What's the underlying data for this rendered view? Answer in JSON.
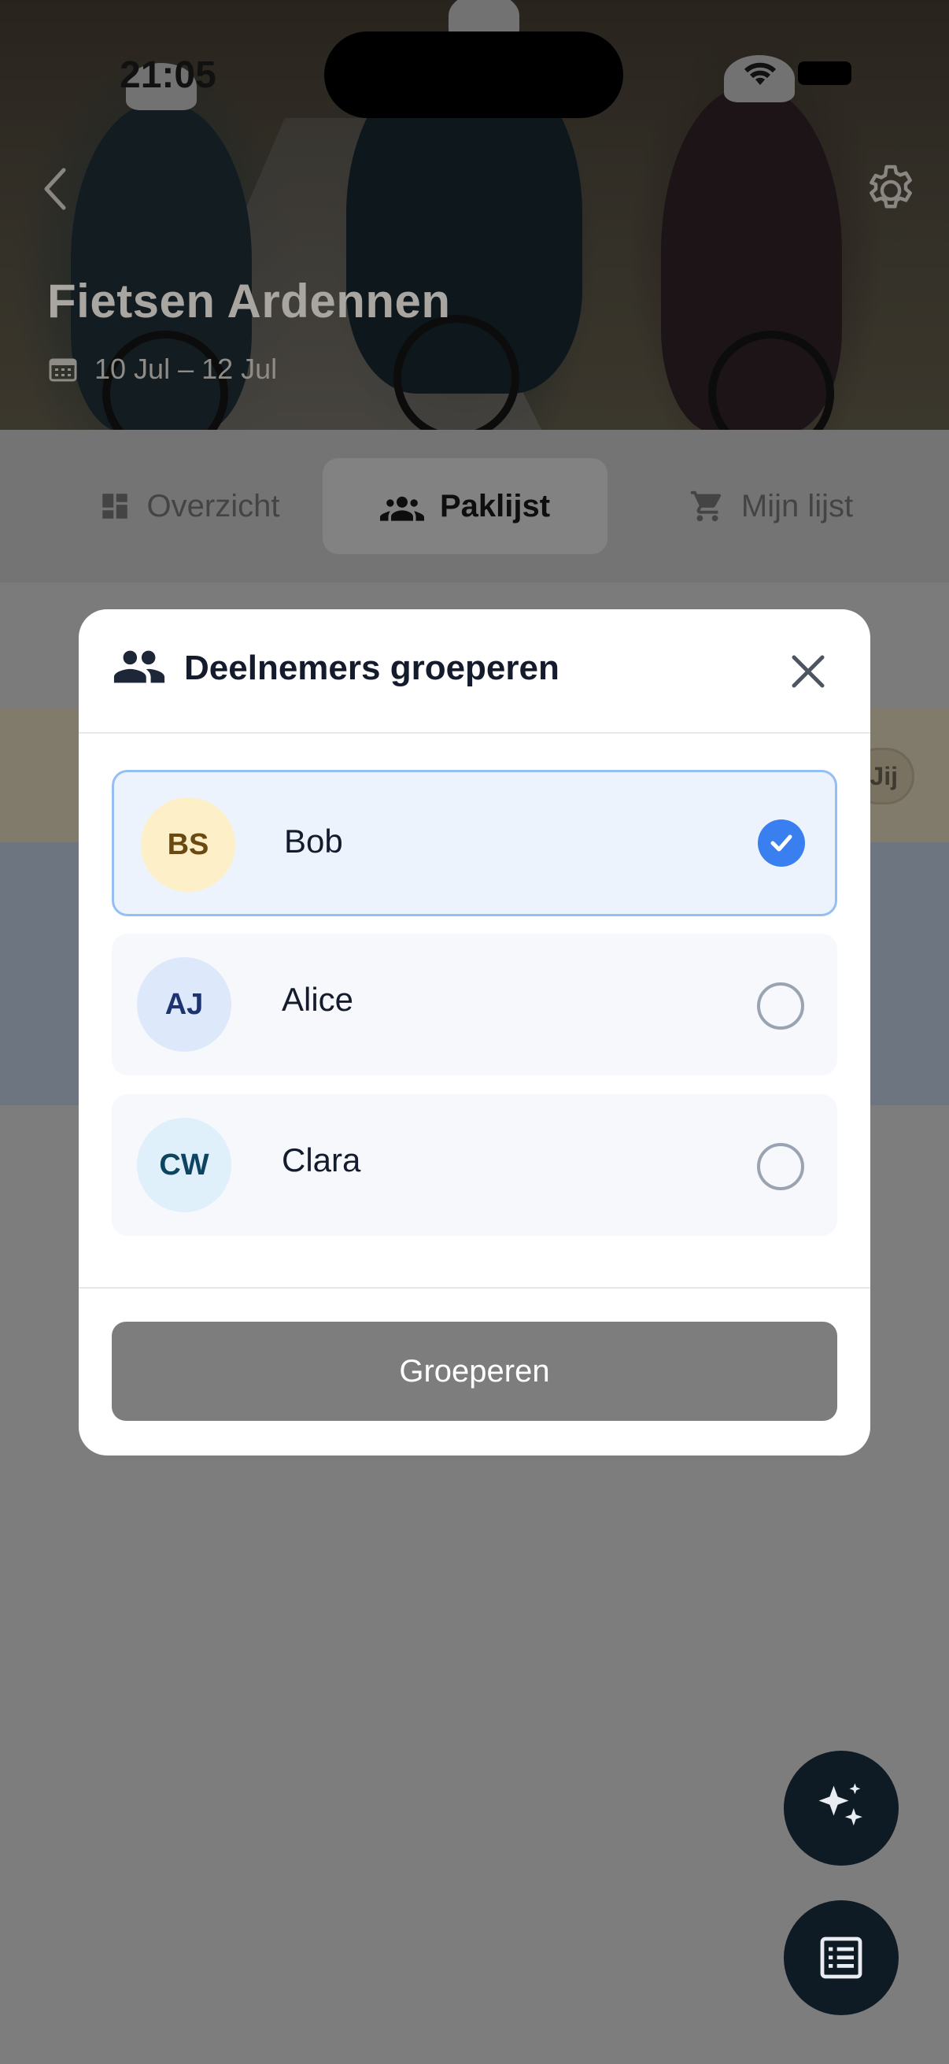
{
  "status_bar": {
    "time": "21:05"
  },
  "trip": {
    "title": "Fietsen Ardennen",
    "dates": "10 Jul – 12 Jul"
  },
  "tabs": [
    {
      "label": "Overzicht",
      "icon": "dashboard-icon",
      "active": false
    },
    {
      "label": "Paklijst",
      "icon": "group-icon",
      "active": true
    },
    {
      "label": "Mijn lijst",
      "icon": "cart-icon",
      "active": false
    }
  ],
  "background_badge": "Jij",
  "modal": {
    "title": "Deelnemers groeperen",
    "icon": "group-icon",
    "members": [
      {
        "initials": "BS",
        "name": "Bob",
        "selected": true,
        "avatar_bg": "#fdf0c8",
        "avatar_fg": "#6b4a12"
      },
      {
        "initials": "AJ",
        "name": "Alice",
        "selected": false,
        "avatar_bg": "#dde9fb",
        "avatar_fg": "#1d3470"
      },
      {
        "initials": "CW",
        "name": "Clara",
        "selected": false,
        "avatar_bg": "#dff0fb",
        "avatar_fg": "#0f4460"
      }
    ],
    "button_label": "Groeperen"
  },
  "colors": {
    "accent": "#3a7ff0",
    "overlay": "#7d7d7d",
    "fab": "#0e1a24"
  }
}
